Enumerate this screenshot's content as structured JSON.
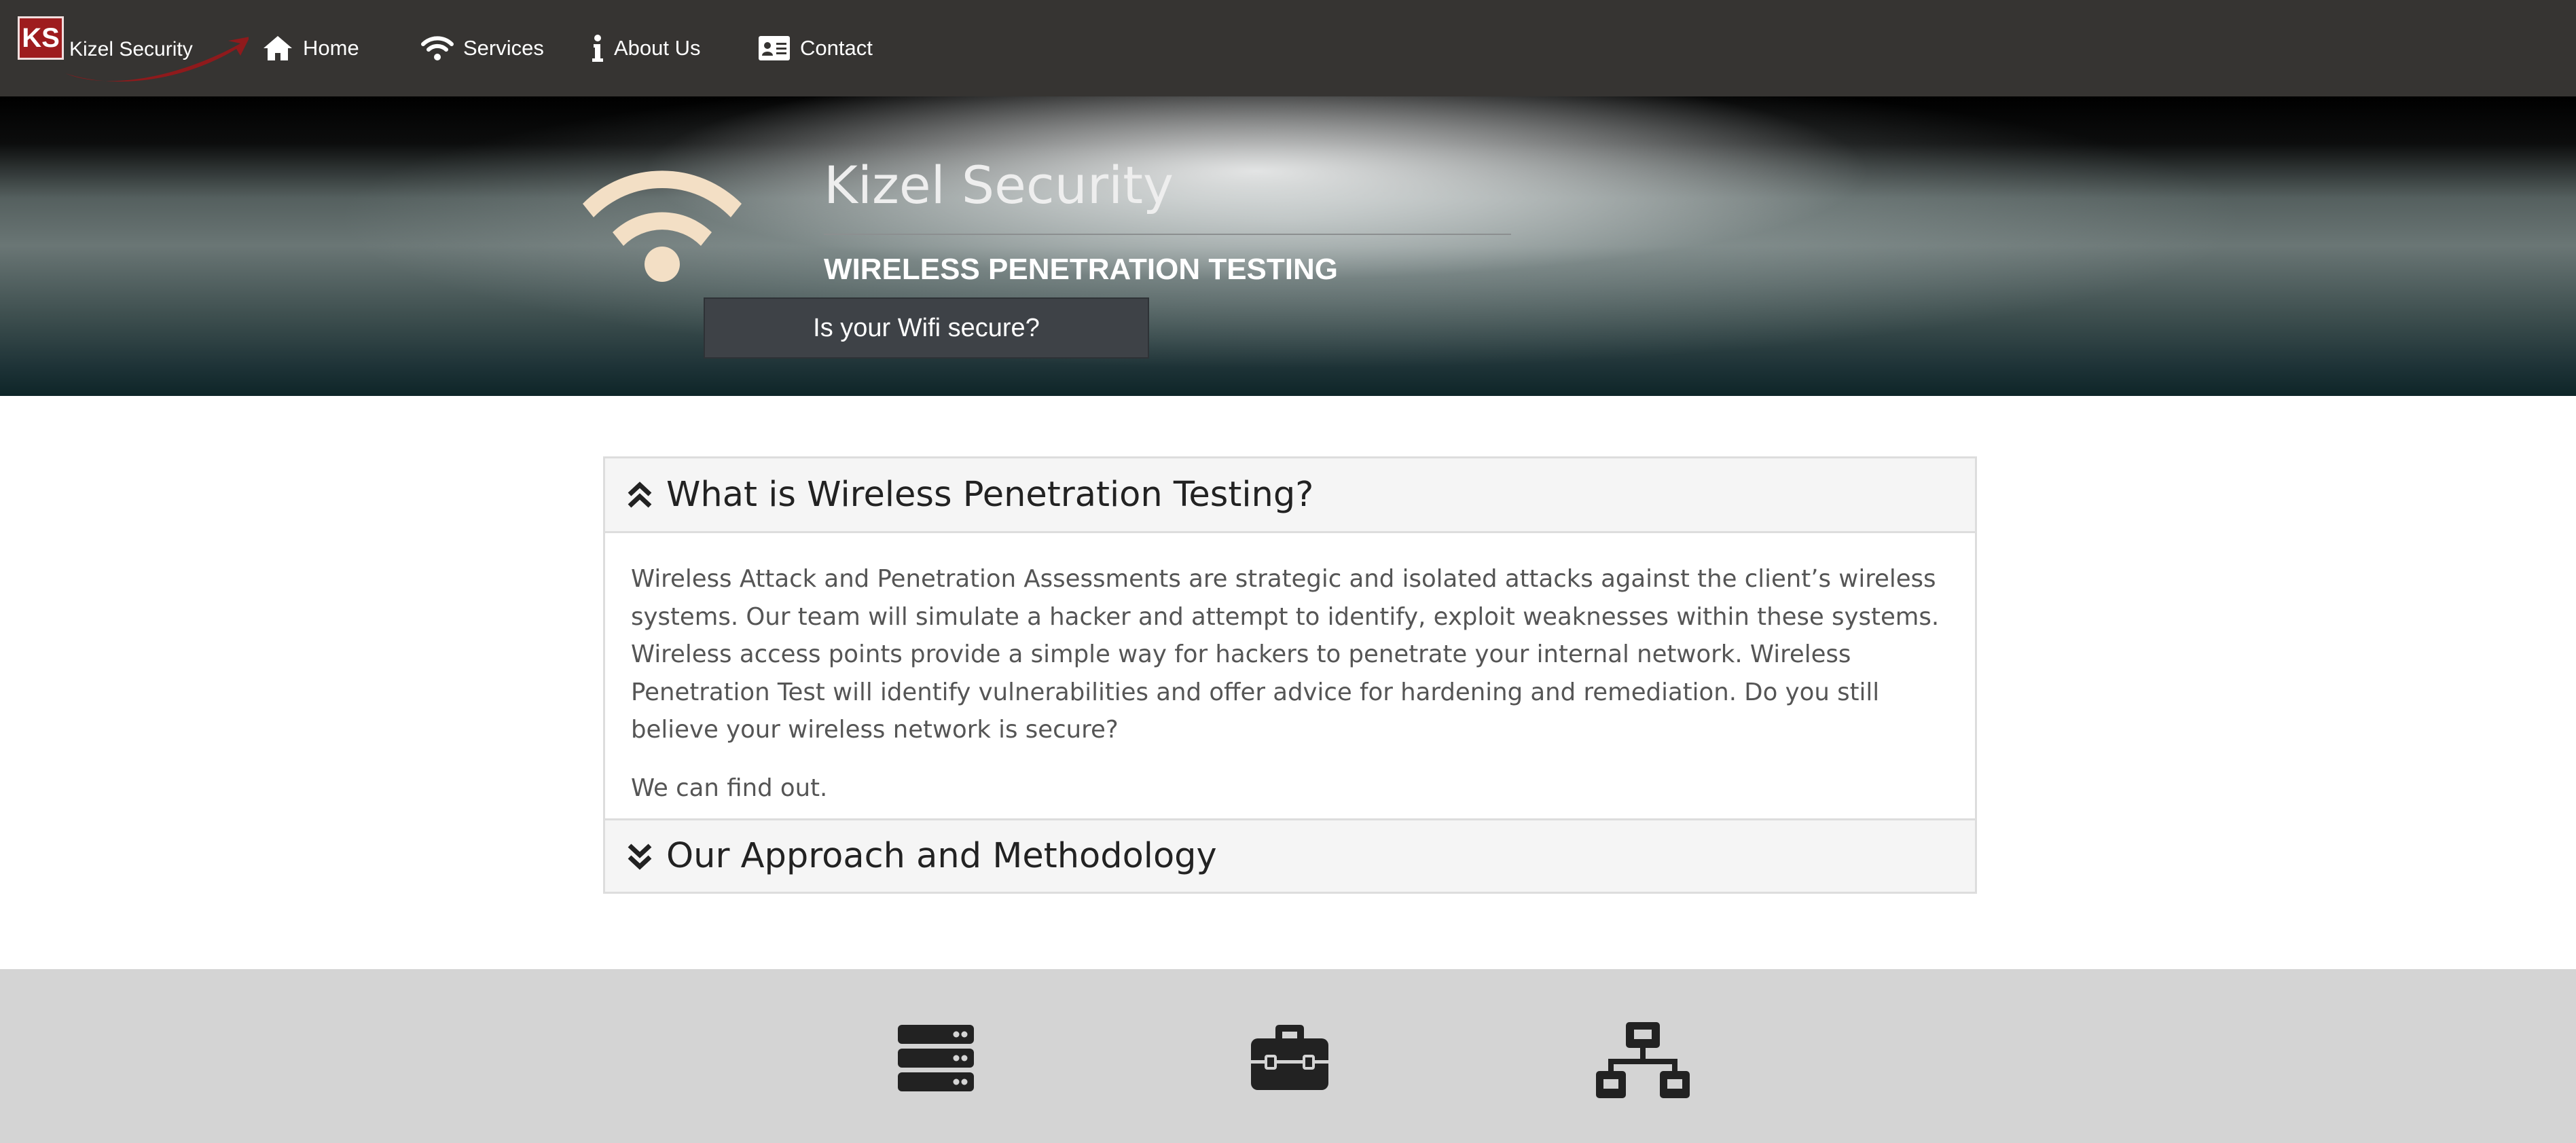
{
  "navbar": {
    "logo_initials": "KS",
    "logo_text": "Kizel Security",
    "items": [
      {
        "label": "Home",
        "icon": "home-icon"
      },
      {
        "label": "Services",
        "icon": "wifi-icon"
      },
      {
        "label": "About Us",
        "icon": "info-icon"
      },
      {
        "label": "Contact",
        "icon": "contact-card-icon"
      }
    ]
  },
  "hero": {
    "icon": "wifi-icon",
    "title": "Kizel Security",
    "subtitle": "WIRELESS PENETRATION TESTING",
    "button_label": "Is your Wifi secure?"
  },
  "accordion": {
    "sections": [
      {
        "title": "What is Wireless Penetration Testing?",
        "icon": "chevron-double-up-icon",
        "expanded": true,
        "paragraphs": [
          "Wireless Attack and Penetration Assessments are strategic and isolated attacks against the client’s wireless systems. Our team will simulate a hacker and attempt to identify, exploit weaknesses within these systems. Wireless access points provide a simple way for hackers to penetrate your internal network. Wireless Penetration Test will identify vulnerabilities and offer advice for hardening and remediation. Do you still believe your wireless network is secure?",
          "We can find out."
        ]
      },
      {
        "title": "Our Approach and Methodology",
        "icon": "chevron-double-down-icon",
        "expanded": false
      }
    ]
  },
  "features": {
    "icons": [
      "server-icon",
      "toolbox-icon",
      "network-icon"
    ]
  },
  "colors": {
    "navbar_bg": "#363432",
    "logo_red": "#9e1c1e",
    "hero_button_bg": "#3e4247",
    "features_bg": "#d4d4d4",
    "icon_dark": "#222222",
    "wifi_cream": "#f3dfc5"
  }
}
